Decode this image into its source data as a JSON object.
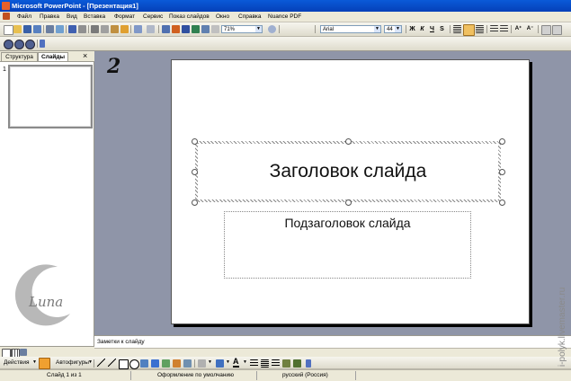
{
  "app": {
    "title": "Microsoft PowerPoint - [Презентация1]"
  },
  "menu": [
    "Файл",
    "Правка",
    "Вид",
    "Вставка",
    "Формат",
    "Сервис",
    "Показ слайдов",
    "Окно",
    "Справка",
    "Nuance PDF"
  ],
  "toolbar": {
    "zoom": "71%",
    "font": "Arial",
    "font_size": "44"
  },
  "format_buttons": [
    "Ж",
    "К",
    "Ч",
    "S",
    "A⁺",
    "A⁻"
  ],
  "left_pane": {
    "tabs": [
      "Структура",
      "Слайды"
    ],
    "close": "×",
    "slide_number": "1"
  },
  "slide": {
    "title": "Заголовок слайда",
    "subtitle": "Подзаголовок слайда"
  },
  "notes": {
    "placeholder": "Заметки к слайду"
  },
  "drawing": {
    "actions": "Действия",
    "autoshapes": "Автофигуры"
  },
  "status": {
    "slide": "Слайд 1 из 1",
    "design": "Оформление по умолчанию",
    "language": "русский (Россия)"
  },
  "overlay": {
    "step_number": "2",
    "logo_text": "Luna",
    "watermark": "i-polyk.livemaster.ru"
  }
}
